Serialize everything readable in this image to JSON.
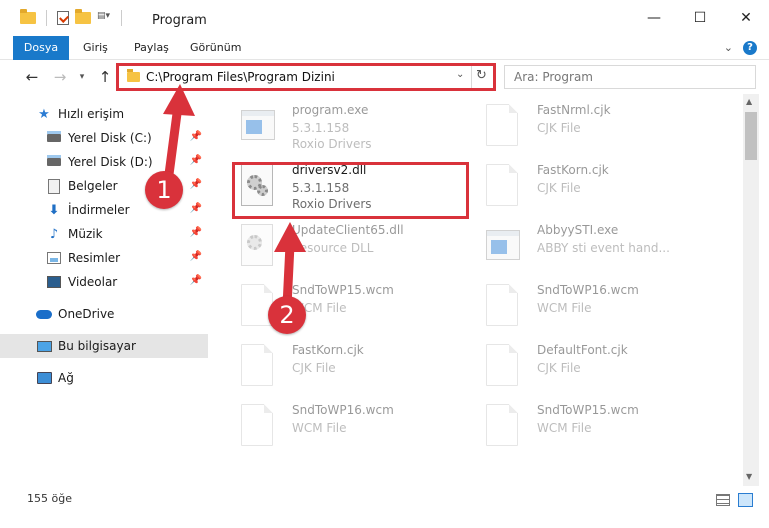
{
  "window": {
    "title": "Program",
    "minimize": "—",
    "maximize": "☐",
    "close": "✕"
  },
  "ribbon": {
    "tabs": [
      "Dosya",
      "Giriş",
      "Paylaş",
      "Görünüm"
    ],
    "collapse": "⌄",
    "help": "?"
  },
  "nav": {
    "address": "C:\\Program Files\\Program Dizini",
    "search_placeholder": "Ara: Program"
  },
  "sidebar": {
    "items": [
      {
        "label": "Hızlı erişim",
        "icon": "star-icon"
      },
      {
        "label": "Yerel Disk (C:)",
        "icon": "disk-icon"
      },
      {
        "label": "Yerel Disk (D:)",
        "icon": "disk-icon"
      },
      {
        "label": "Belgeler",
        "icon": "documents-icon"
      },
      {
        "label": "İndirmeler",
        "icon": "download-icon"
      },
      {
        "label": "Müzik",
        "icon": "music-icon"
      },
      {
        "label": "Resimler",
        "icon": "pictures-icon"
      },
      {
        "label": "Videolar",
        "icon": "video-icon"
      },
      {
        "label": "OneDrive",
        "icon": "cloud-icon"
      },
      {
        "label": "Bu bilgisayar",
        "icon": "computer-icon"
      },
      {
        "label": "Ağ",
        "icon": "network-icon"
      }
    ]
  },
  "files": [
    {
      "name": "program.exe",
      "line1": "5.3.1.158",
      "line2": "Roxio Drivers"
    },
    {
      "name": "FastNrml.cjk",
      "line1": "CJK File",
      "line2": ""
    },
    {
      "name": "driversv2.dll",
      "line1": "5.3.1.158",
      "line2": "Roxio Drivers"
    },
    {
      "name": "FastKorn.cjk",
      "line1": "CJK File",
      "line2": ""
    },
    {
      "name": "UpdateClient65.dll",
      "line1": "Resource DLL",
      "line2": ""
    },
    {
      "name": "AbbyySTI.exe",
      "line1": "ABBY sti event hand...",
      "line2": ""
    },
    {
      "name": "SndToWP15.wcm",
      "line1": "WCM File",
      "line2": ""
    },
    {
      "name": "SndToWP16.wcm",
      "line1": "WCM File",
      "line2": ""
    },
    {
      "name": "FastKorn.cjk",
      "line1": "CJK File",
      "line2": ""
    },
    {
      "name": "DefaultFont.cjk",
      "line1": "CJK File",
      "line2": ""
    },
    {
      "name": "SndToWP16.wcm",
      "line1": "WCM File",
      "line2": ""
    },
    {
      "name": "SndToWP15.wcm",
      "line1": "WCM File",
      "line2": ""
    }
  ],
  "status": {
    "count": "155 öğe"
  },
  "annotations": {
    "badge1": "1",
    "badge2": "2",
    "color": "#d9323b"
  }
}
